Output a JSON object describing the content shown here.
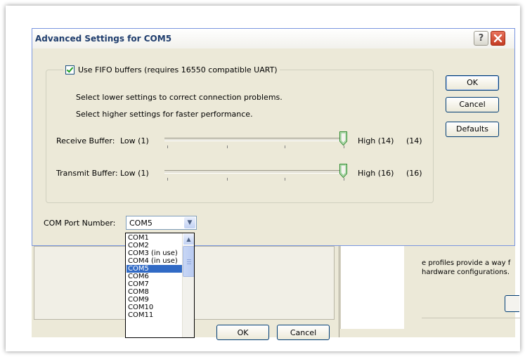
{
  "dialog": {
    "title": "Advanced Settings for COM5",
    "help_label": "?",
    "fifo": {
      "checked": true,
      "label": "Use FIFO buffers (requires 16550 compatible UART)"
    },
    "hint_lower": "Select lower settings to correct connection problems.",
    "hint_higher": "Select higher settings for faster performance.",
    "receive": {
      "label": "Receive Buffer:",
      "low": "Low (1)",
      "high": "High (14)",
      "value": "(14)",
      "level": 1.0
    },
    "transmit": {
      "label": "Transmit Buffer:",
      "low": "Low (1)",
      "high": "High (16)",
      "value": "(16)",
      "level": 1.0
    },
    "buttons": {
      "ok": "OK",
      "cancel": "Cancel",
      "defaults": "Defaults"
    },
    "com_port": {
      "label": "COM Port Number:",
      "value": "COM5",
      "options": [
        "COM1",
        "COM2",
        "COM3 (in use)",
        "COM4 (in use)",
        "COM5",
        "COM6",
        "COM7",
        "COM8",
        "COM9",
        "COM10",
        "COM11"
      ],
      "selected": "COM5"
    }
  },
  "background_window": {
    "right_text_1": "e profiles provide a way f",
    "right_text_2": "hardware configurations.",
    "ok_label": "OK",
    "cancel_label": "Cancel"
  },
  "colors": {
    "dialog_bg": "#ece9d8",
    "title_text": "#1f3d6d",
    "selection": "#316ac5",
    "close_button": "#c33c24"
  },
  "icons": {
    "checkbox": "checkmark-icon",
    "dropdown": "chevron-down-icon",
    "scroll_up": "chevron-up-icon",
    "close": "close-icon",
    "help": "help-icon"
  }
}
